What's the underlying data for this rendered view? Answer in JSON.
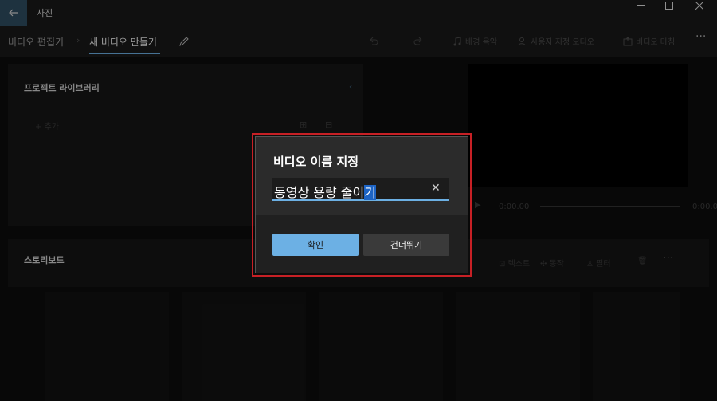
{
  "app": {
    "title": "사진",
    "breadcrumbs": [
      "비디오 편집기",
      "새 비디오 만들기"
    ]
  },
  "toolbar": {
    "background_music": "배경 음악",
    "custom_audio": "사용자 지정 오디오",
    "finish_video": "비디오 마침"
  },
  "library": {
    "title": "프로젝트 라이브러리",
    "add_label": "추가"
  },
  "player": {
    "current_time": "0:00.00",
    "total_time": "0:00.0"
  },
  "storyboard": {
    "title": "스토리보드",
    "text_label": "텍스트",
    "motion_label": "동작",
    "filter_label": "필터"
  },
  "dialog": {
    "title": "비디오 이름 지정",
    "input_value_prefix": "동영상 용량 줄이",
    "input_value_selected": "기",
    "confirm_label": "확인",
    "skip_label": "건너뛰기"
  },
  "colors": {
    "accent": "#6cb0e4",
    "highlight_frame": "#c72025",
    "selection": "#1d64c5"
  }
}
